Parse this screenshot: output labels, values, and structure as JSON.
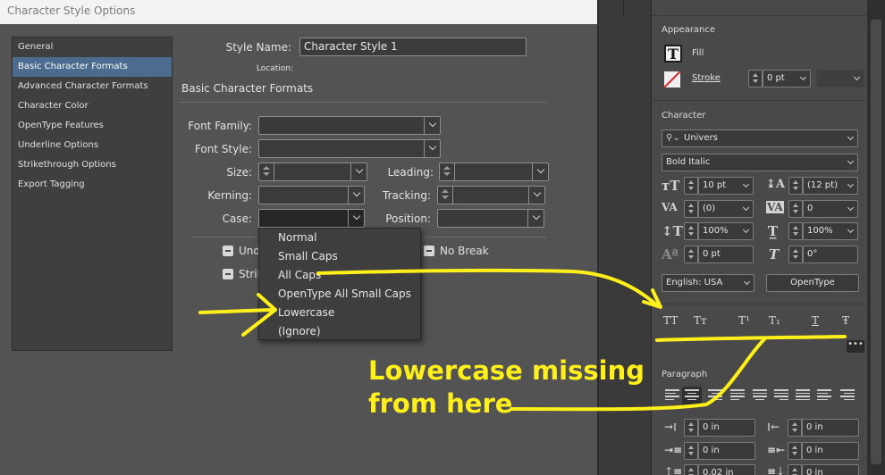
{
  "dialog": {
    "title": "Character Style Options",
    "categories": [
      {
        "label": "General",
        "selected": false
      },
      {
        "label": "Basic Character Formats",
        "selected": true
      },
      {
        "label": "Advanced Character Formats",
        "selected": false
      },
      {
        "label": "Character Color",
        "selected": false
      },
      {
        "label": "OpenType Features",
        "selected": false
      },
      {
        "label": "Underline Options",
        "selected": false
      },
      {
        "label": "Strikethrough Options",
        "selected": false
      },
      {
        "label": "Export Tagging",
        "selected": false
      }
    ],
    "style_name_label": "Style Name:",
    "style_name_value": "Character Style 1",
    "location_label": "Location:",
    "section_title": "Basic Character Formats",
    "font_family_label": "Font Family:",
    "font_style_label": "Font Style:",
    "size_label": "Size:",
    "leading_label": "Leading:",
    "kerning_label": "Kerning:",
    "tracking_label": "Tracking:",
    "case_label": "Case:",
    "position_label": "Position:",
    "underline_label_partial": "Und",
    "strikethrough_label_partial": "Strik",
    "no_break_label": "No Break",
    "case_options": [
      "Normal",
      "Small Caps",
      "All Caps",
      "OpenType All Small Caps",
      "Lowercase",
      "(Ignore)"
    ]
  },
  "panel": {
    "appearance_title": "Appearance",
    "fill_label": "Fill",
    "stroke_label": "Stroke",
    "stroke_value": "0 pt",
    "character_title": "Character",
    "font_family": "Univers",
    "font_style": "Bold Italic",
    "font_size": "10 pt",
    "leading": "(12 pt)",
    "kerning": "(0)",
    "tracking": "0",
    "vertical_scale": "100%",
    "horizontal_scale": "100%",
    "baseline_shift": "0 pt",
    "skew": "0°",
    "language": "English: USA",
    "opentype_button": "OpenType",
    "format_buttons": [
      "TT",
      "Tт",
      "T¹",
      "T₁",
      "T",
      "Ŧ"
    ],
    "ellipsis": "•••",
    "paragraph_title": "Paragraph",
    "left_indent": "0 in",
    "right_indent": "0 in",
    "first_line_indent": "0 in",
    "last_line_indent": "0 in",
    "space_before": "0.02 in",
    "space_after": "0 in"
  },
  "annotation": {
    "line1": "Lowercase missing",
    "line2": "from here",
    "color": "#ffef1a"
  },
  "colors": {
    "selection": "#4b6c8e",
    "annotation": "#ffef1a"
  }
}
